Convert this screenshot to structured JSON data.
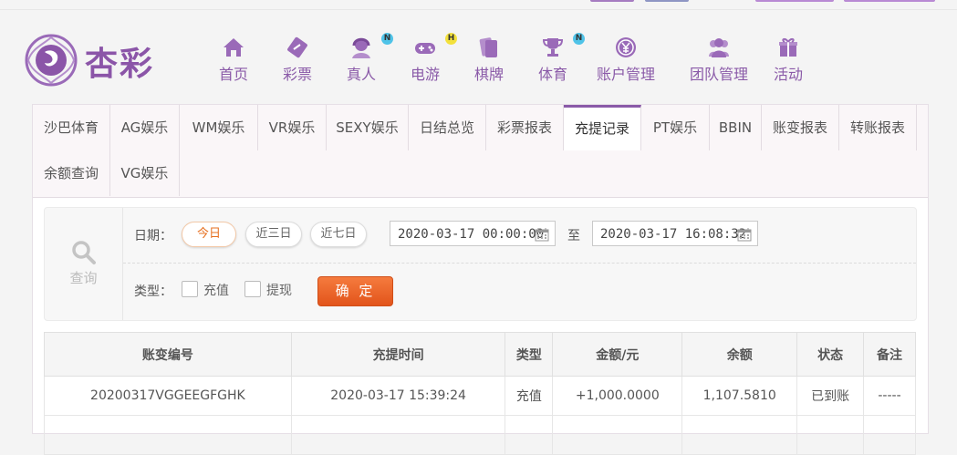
{
  "brand": {
    "name": "杏彩",
    "accent": "#8a5aa8"
  },
  "nav": [
    {
      "label": "首页",
      "icon": "home-icon"
    },
    {
      "label": "彩票",
      "icon": "lottery-ticket-icon"
    },
    {
      "label": "真人",
      "icon": "live-dealer-icon",
      "badge": "N"
    },
    {
      "label": "电游",
      "icon": "gamepad-icon",
      "badge": "H"
    },
    {
      "label": "棋牌",
      "icon": "cards-icon"
    },
    {
      "label": "体育",
      "icon": "trophy-icon",
      "badge": "N"
    },
    {
      "label": "账户管理",
      "icon": "yen-coin-icon"
    },
    {
      "label": "团队管理",
      "icon": "team-icon"
    },
    {
      "label": "活动",
      "icon": "gift-icon"
    }
  ],
  "tabs": [
    "沙巴体育",
    "AG娱乐",
    "WM娱乐",
    "VR娱乐",
    "SEXY娱乐",
    "日结总览",
    "彩票报表",
    "充提记录",
    "PT娱乐",
    "BBIN",
    "账变报表",
    "转账报表",
    "余额查询",
    "VG娱乐"
  ],
  "active_tab": "充提记录",
  "filter": {
    "query_label": "查询",
    "date_label": "日期：",
    "quick_ranges": [
      "今日",
      "近三日",
      "近七日"
    ],
    "selected_range": "今日",
    "start_date": "2020-03-17 00:00:00",
    "to_label": "至",
    "end_date": "2020-03-17 16:08:32",
    "type_label": "类型：",
    "types": [
      "充值",
      "提现"
    ],
    "confirm_label": "确 定"
  },
  "table": {
    "headers": [
      "账变编号",
      "充提时间",
      "类型",
      "金额/元",
      "余额",
      "状态",
      "备注"
    ],
    "rows": [
      [
        "20200317VGGEEGFGHK",
        "2020-03-17 15:39:24",
        "充值",
        "+1,000.0000",
        "1,107.5810",
        "已到账",
        "-----"
      ]
    ]
  }
}
